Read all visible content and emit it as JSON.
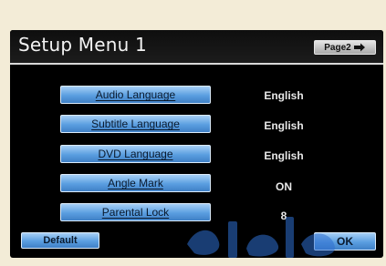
{
  "screen": {
    "title": "Setup Menu 1",
    "page_button_label": "Page2",
    "page_button_icon": "arrow-right-icon"
  },
  "menu": {
    "items": [
      {
        "label": "Audio Language",
        "value": "English"
      },
      {
        "label": "Subtitle Language",
        "value": "English"
      },
      {
        "label": "DVD Language",
        "value": "English"
      },
      {
        "label": "Angle Mark",
        "value": "ON"
      },
      {
        "label": "Parental Lock",
        "value": "8"
      }
    ]
  },
  "footer": {
    "default_label": "Default",
    "ok_label": "OK"
  },
  "colors": {
    "button_blue": "#5a9ee0",
    "screen_bg": "#000000",
    "frame_bg": "#f3ecd7"
  }
}
